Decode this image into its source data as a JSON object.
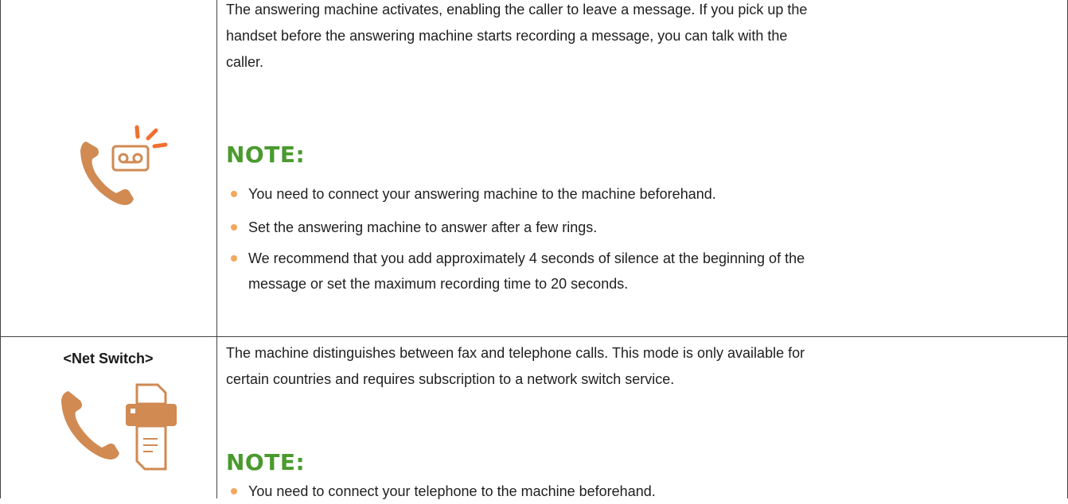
{
  "row1": {
    "description": "The answering machine activates, enabling the caller to leave a message. If you pick up the handset before the answering machine starts recording a message, you can talk with the caller.",
    "desc_lines": [
      "The answering machine activates, enabling the caller to leave a message. If you pick up the",
      "handset before the answering machine starts recording a message, you can talk with the",
      "caller."
    ],
    "note_title": "NOTE:",
    "notes": [
      [
        "You need to connect your answering machine to the machine beforehand."
      ],
      [
        "Set the answering machine to answer after a few rings."
      ],
      [
        "We recommend that you add approximately 4 seconds of silence at the beginning of the",
        "message or set the maximum recording time to 20 seconds."
      ]
    ],
    "icon": "phone-answering-machine-icon"
  },
  "row2": {
    "mode_label": "<Net Switch>",
    "desc_lines": [
      "The machine distinguishes between fax and telephone calls. This mode is only available for",
      "certain countries and requires subscription to a network switch service."
    ],
    "note_title": "NOTE:",
    "notes": [
      [
        "You need to connect your telephone to the machine beforehand."
      ]
    ],
    "icon": "phone-fax-icon"
  },
  "colors": {
    "note_green": "#4a9a2e",
    "icon_orange": "#d08a52",
    "bullet_orange": "#f3a85c",
    "border": "#444444"
  }
}
